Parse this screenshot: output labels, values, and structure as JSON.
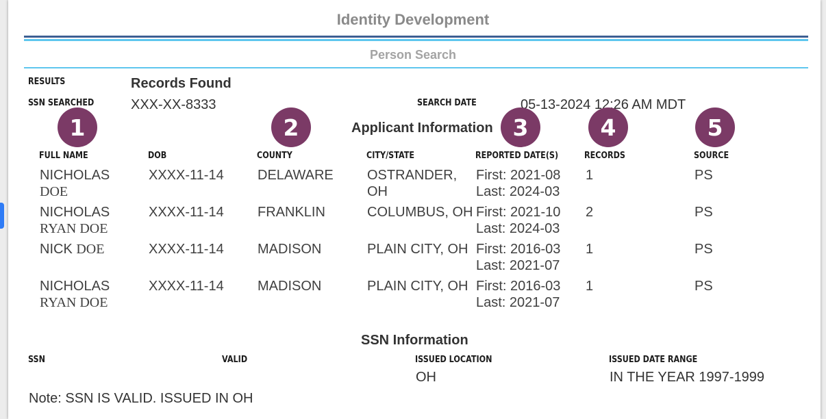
{
  "header": {
    "title": "Identity Development",
    "subtitle": "Person Search"
  },
  "results": {
    "results_label": "RESULTS",
    "records_found": "Records Found",
    "ssn_searched_label": "SSN SEARCHED",
    "ssn_searched_value": "XXX-XX-8333",
    "search_date_label": "SEARCH DATE",
    "search_date_value": "05-13-2024 12:26 AM MDT"
  },
  "applicant": {
    "heading": "Applicant Information",
    "columns": [
      "FULL NAME",
      "DOB",
      "COUNTY",
      "CITY/STATE",
      "REPORTED DATE(S)",
      "RECORDS",
      "SOURCE"
    ],
    "rows": [
      {
        "name1": "NICHOLAS",
        "name2": "DOE",
        "dob": "XXXX-11-14",
        "county": "DELAWARE",
        "city1": "OSTRANDER,",
        "city2": "OH",
        "first": "First: 2021-08",
        "last": "Last: 2024-03",
        "records": "1",
        "source": "PS"
      },
      {
        "name1": "NICHOLAS",
        "name2": "RYAN DOE",
        "dob": "XXXX-11-14",
        "county": "FRANKLIN",
        "city1": "COLUMBUS, OH",
        "city2": "",
        "first": "First: 2021-10",
        "last": "Last: 2024-03",
        "records": "2",
        "source": "PS"
      },
      {
        "name1": "NICK DOE",
        "name2": "",
        "dob": "XXXX-11-14",
        "county": "MADISON",
        "city1": "PLAIN CITY, OH",
        "city2": "",
        "first": "First: 2016-03",
        "last": "Last: 2021-07",
        "records": "1",
        "source": "PS"
      },
      {
        "name1": "NICHOLAS",
        "name2": "RYAN DOE",
        "dob": "XXXX-11-14",
        "county": "MADISON",
        "city1": "PLAIN CITY, OH",
        "city2": "",
        "first": "First: 2016-03",
        "last": "Last: 2021-07",
        "records": "1",
        "source": "PS"
      }
    ]
  },
  "badges": [
    "1",
    "2",
    "3",
    "4",
    "5"
  ],
  "ssn_info": {
    "heading": "SSN Information",
    "columns": [
      "SSN",
      "VALID",
      "ISSUED LOCATION",
      "ISSUED DATE RANGE"
    ],
    "issued_location": "OH",
    "issued_date_range": "IN THE YEAR 1997-1999",
    "note": "Note: SSN IS VALID. ISSUED IN OH"
  },
  "colors": {
    "badge": "#7b3a66",
    "accent_dark": "#3d5f93",
    "accent_light": "#5ec6ee"
  }
}
